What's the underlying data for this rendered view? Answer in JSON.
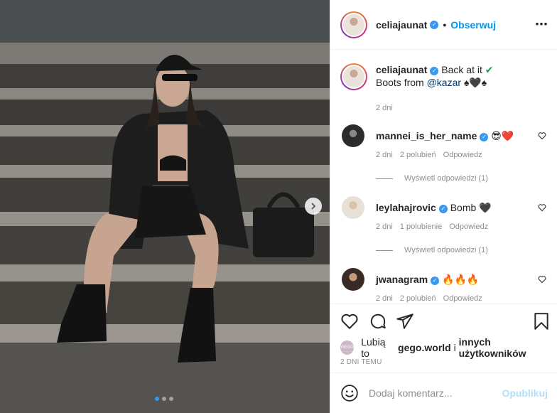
{
  "post": {
    "username": "celiajaunat",
    "follow_label": "Obserwuj",
    "caption_text": "Back at it",
    "caption_line2_prefix": "Boots from",
    "caption_mention": "@kazar",
    "caption_suits": "♠🖤♠",
    "caption_time": "2 dni",
    "photo_alt": "Woman in black outfit sitting on stone stairs",
    "carousel_index": 1,
    "carousel_count": 3
  },
  "comments": [
    {
      "username": "mannei_is_her_name",
      "text": "😎❤️",
      "time": "2 dni",
      "likes": "2 polubień",
      "reply": "Odpowiedz",
      "view_replies": "Wyświetl odpowiedzi (1)"
    },
    {
      "username": "leylahajrovic",
      "text": "Bomb 🖤",
      "time": "2 dni",
      "likes": "1 polubienie",
      "reply": "Odpowiedz",
      "view_replies": "Wyświetl odpowiedzi (1)"
    },
    {
      "username": "jwanagram",
      "text": "🔥🔥🔥",
      "time": "2 dni",
      "likes": "2 polubień",
      "reply": "Odpowiedz"
    }
  ],
  "likes_bar": {
    "prefix": "Lubią to",
    "user": "gego.world",
    "middle": "i",
    "others": "innych użytkowników"
  },
  "timestamp": "2 DNI TEMU",
  "add_comment": {
    "placeholder": "Dodaj komentarz...",
    "publish_label": "Opublikuj"
  },
  "colors": {
    "accent": "#0095f6",
    "verified": "#3897f0",
    "heart": "#ed4956",
    "muted": "#8e8e8e"
  }
}
